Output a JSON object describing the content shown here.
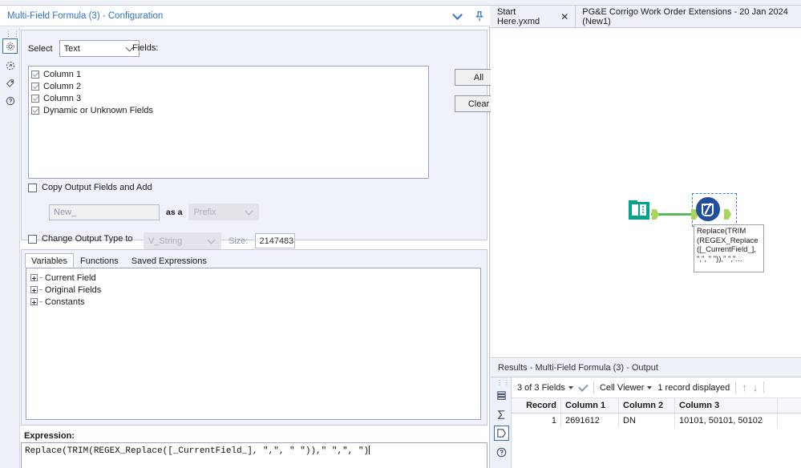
{
  "config": {
    "title": "Multi-Field Formula (3) - Configuration",
    "collapse_icon": "chevron-down-icon",
    "pin_icon": "pin-icon",
    "rail_icons": [
      "gear-icon",
      "refresh-circle-icon",
      "tag-icon",
      "question-circle-icon"
    ],
    "select_label": "Select",
    "select_value": "Text",
    "fields_label": "Fields:",
    "fields": [
      {
        "label": "Column 1",
        "checked": true
      },
      {
        "label": "Column 2",
        "checked": true
      },
      {
        "label": "Column 3",
        "checked": true
      },
      {
        "label": "Dynamic or Unknown Fields",
        "checked": true
      }
    ],
    "all_button": "All",
    "clear_button": "Clear",
    "copy_output_label": "Copy Output Fields and Add",
    "copy_output_checked": false,
    "new_field_value": "New_",
    "as_a_label": "as a",
    "prefix_value": "Prefix",
    "change_type_label": "Change Output Type to",
    "change_type_checked": false,
    "output_type_value": "V_String",
    "size_label": "Size:",
    "size_value": "2147483",
    "tabs": [
      {
        "label": "Variables",
        "active": true
      },
      {
        "label": "Functions",
        "active": false
      },
      {
        "label": "Saved Expressions",
        "active": false
      }
    ],
    "tree": [
      "Current Field",
      "Original Fields",
      "Constants"
    ],
    "expression_label": "Expression:",
    "expression_value": "Replace(TRIM(REGEX_Replace([_CurrentField_], \",\", \" \")),\" \",\", \")"
  },
  "workspace": {
    "doc_tabs": [
      {
        "label": "Start Here.yxmd",
        "close": "✕",
        "active": false
      },
      {
        "label": "PG&E Corrigo Work Order Extensions - 20 Jan 2024 (New1)",
        "active": true
      }
    ],
    "nodes": [
      {
        "name": "input-data-tool",
        "icon": "book-icon",
        "color": "#00a38d"
      },
      {
        "name": "multi-field-formula-tool",
        "icon": "beaker-icon",
        "color": "#1f4e9c"
      }
    ],
    "annotation": "Replace(TRIM (REGEX_Replace ([_CurrentField_], \",\", \" \")),\" \",\"..."
  },
  "results": {
    "title": "Results - Multi-Field Formula (3) - Output",
    "rail_icons": [
      "records-icon",
      "sigma-icon",
      "output-anchor-icon",
      "question-circle-icon"
    ],
    "fields_selector": "3 of 3 Fields",
    "check_icon": "checkmark-icon",
    "viewer_selector": "Cell Viewer",
    "record_count": "1 record displayed",
    "up_arrow": "↑",
    "down_arrow": "↓",
    "columns": [
      "Record",
      "Column 1",
      "Column 2",
      "Column 3"
    ],
    "rows": [
      {
        "record": "1",
        "c1": "2691612",
        "c2": "DN",
        "c3": "10101, 50101, 50102"
      }
    ]
  }
}
